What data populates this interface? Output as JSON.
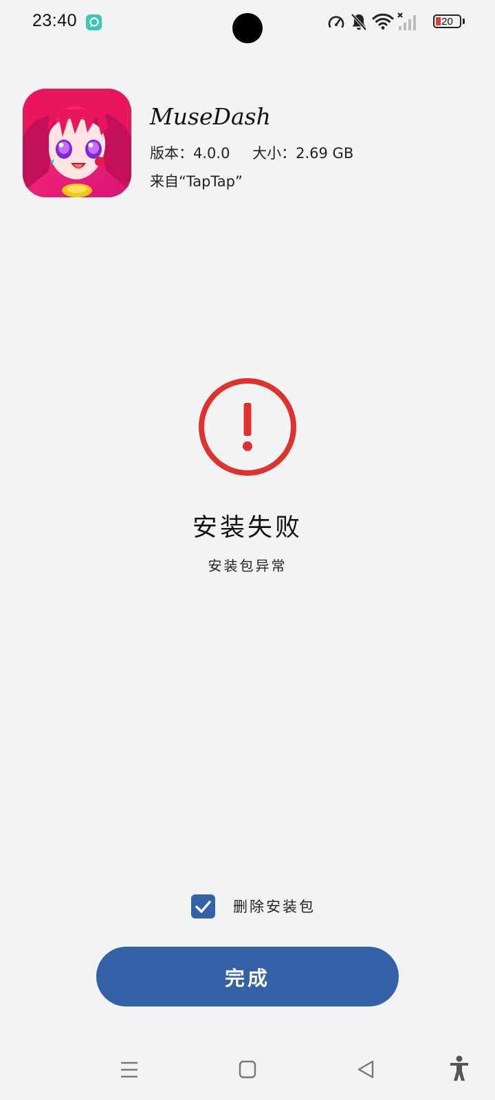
{
  "status_bar": {
    "time": "23:40",
    "battery_level": "20",
    "icons": [
      "app-notification-icon",
      "speedometer-icon",
      "bell-muted-icon",
      "wifi-icon",
      "signal-no-service-icon",
      "battery-icon"
    ],
    "battery_fill_color": "#e53935"
  },
  "app": {
    "icon": "musedash-app-icon",
    "name": "MuseDash",
    "version": "版本：4.0.0",
    "size": "大小：2.69 GB",
    "source": "来自“TapTap”"
  },
  "result": {
    "status_icon": "error-exclamation-icon",
    "status_color": "#e03131",
    "title": "安装失败",
    "subtitle": "安装包异常"
  },
  "options": {
    "delete_package_checked": true,
    "delete_package_label": "删除安装包"
  },
  "actions": {
    "done_label": "完成",
    "accent_color": "#3461a6"
  },
  "nav_bar": {
    "items": [
      "menu-icon",
      "home-icon",
      "back-icon",
      "accessibility-icon"
    ]
  }
}
